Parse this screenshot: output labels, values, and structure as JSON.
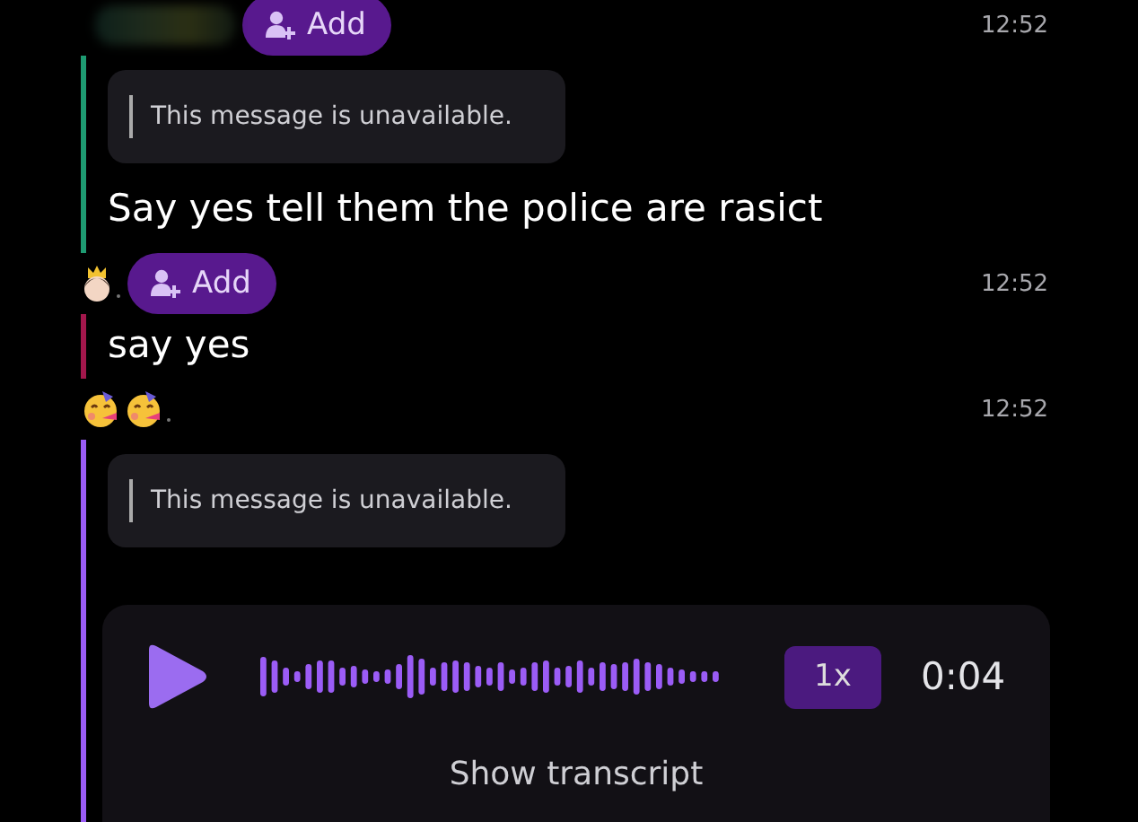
{
  "messages": [
    {
      "sender": {
        "kind": "blurred"
      },
      "add_button": "Add",
      "time": "12:52",
      "color": "#1e9b72",
      "items": [
        {
          "kind": "quote",
          "text": "This message is unavailable."
        },
        {
          "kind": "text",
          "text": "Say yes tell them the police are rasict"
        }
      ]
    },
    {
      "sender": {
        "kind": "emoji",
        "icons": [
          {
            "kind": "princess"
          }
        ]
      },
      "add_button": "Add",
      "time": "12:52",
      "color": "#a3174c",
      "items": [
        {
          "kind": "text",
          "text": "say yes"
        }
      ]
    },
    {
      "sender": {
        "kind": "emoji",
        "icons": [
          {
            "kind": "party"
          },
          {
            "kind": "party"
          }
        ]
      },
      "time": "12:52",
      "color": "#9b5cf6",
      "items": [
        {
          "kind": "quote",
          "text": "This message is unavailable."
        },
        {
          "kind": "voice",
          "speed": "1x",
          "duration": "0:04",
          "transcript": "Show transcript"
        }
      ]
    }
  ]
}
